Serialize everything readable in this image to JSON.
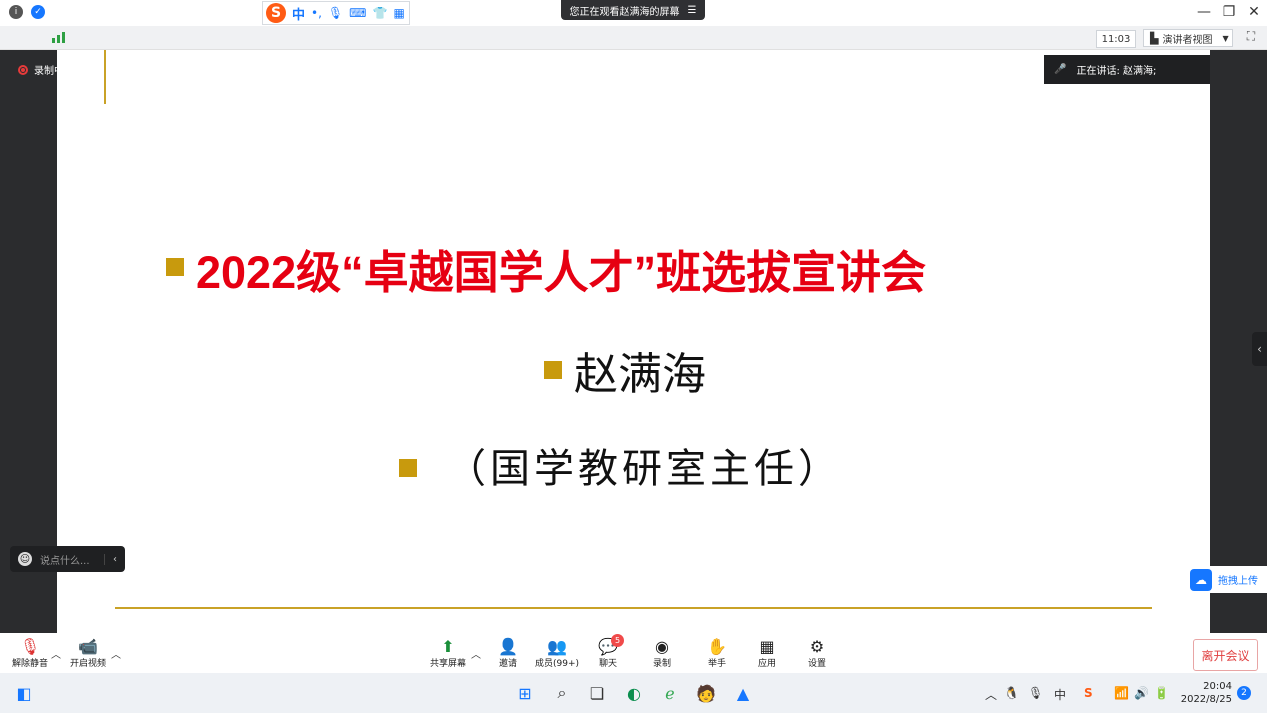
{
  "topbar": {
    "ime": {
      "logo": "S",
      "mode": "中",
      "icons": [
        "punctuation-icon",
        "microphone-icon",
        "keyboard-icon",
        "skin-icon",
        "grid-icon"
      ]
    },
    "share_status": "您正在观看赵满海的屏幕",
    "window_controls": [
      "minimize-icon",
      "restore-icon",
      "close-icon"
    ]
  },
  "infobar": {
    "time": "11:03",
    "view_mode": "演讲者视图"
  },
  "slide": {
    "title": "2022级“卓越国学人才”班选拔宣讲会",
    "speaker": "赵满海",
    "role": "（国学教研室主任）",
    "bullet_color": "#c89a0d",
    "title_color": "#e60012"
  },
  "overlays": {
    "recording": "录制中",
    "speaking": "正在讲话: 赵满海;",
    "chat_placeholder": "说点什么...",
    "upload": "拖拽上传"
  },
  "toolbar": {
    "left": [
      {
        "name": "unmute-button",
        "label": "解除静音",
        "icon": "mic-muted-icon"
      },
      {
        "name": "start-video-button",
        "label": "开启视频",
        "icon": "video-off-icon"
      }
    ],
    "center": [
      {
        "name": "share-screen-button",
        "label": "共享屏幕",
        "icon": "share-screen-icon"
      },
      {
        "name": "invite-button",
        "label": "邀请",
        "icon": "invite-icon"
      },
      {
        "name": "members-button",
        "label": "成员(99+)",
        "icon": "members-icon"
      },
      {
        "name": "chat-button",
        "label": "聊天",
        "icon": "chat-icon",
        "badge": "5"
      },
      {
        "name": "record-button",
        "label": "录制",
        "icon": "record-icon"
      },
      {
        "name": "raise-hand-button",
        "label": "举手",
        "icon": "hand-icon"
      },
      {
        "name": "apps-button",
        "label": "应用",
        "icon": "apps-icon"
      },
      {
        "name": "settings-button",
        "label": "设置",
        "icon": "gear-icon"
      }
    ],
    "leave": "离开会议"
  },
  "taskbar": {
    "time": "20:04",
    "date": "2022/8/25",
    "notifications": "2"
  }
}
